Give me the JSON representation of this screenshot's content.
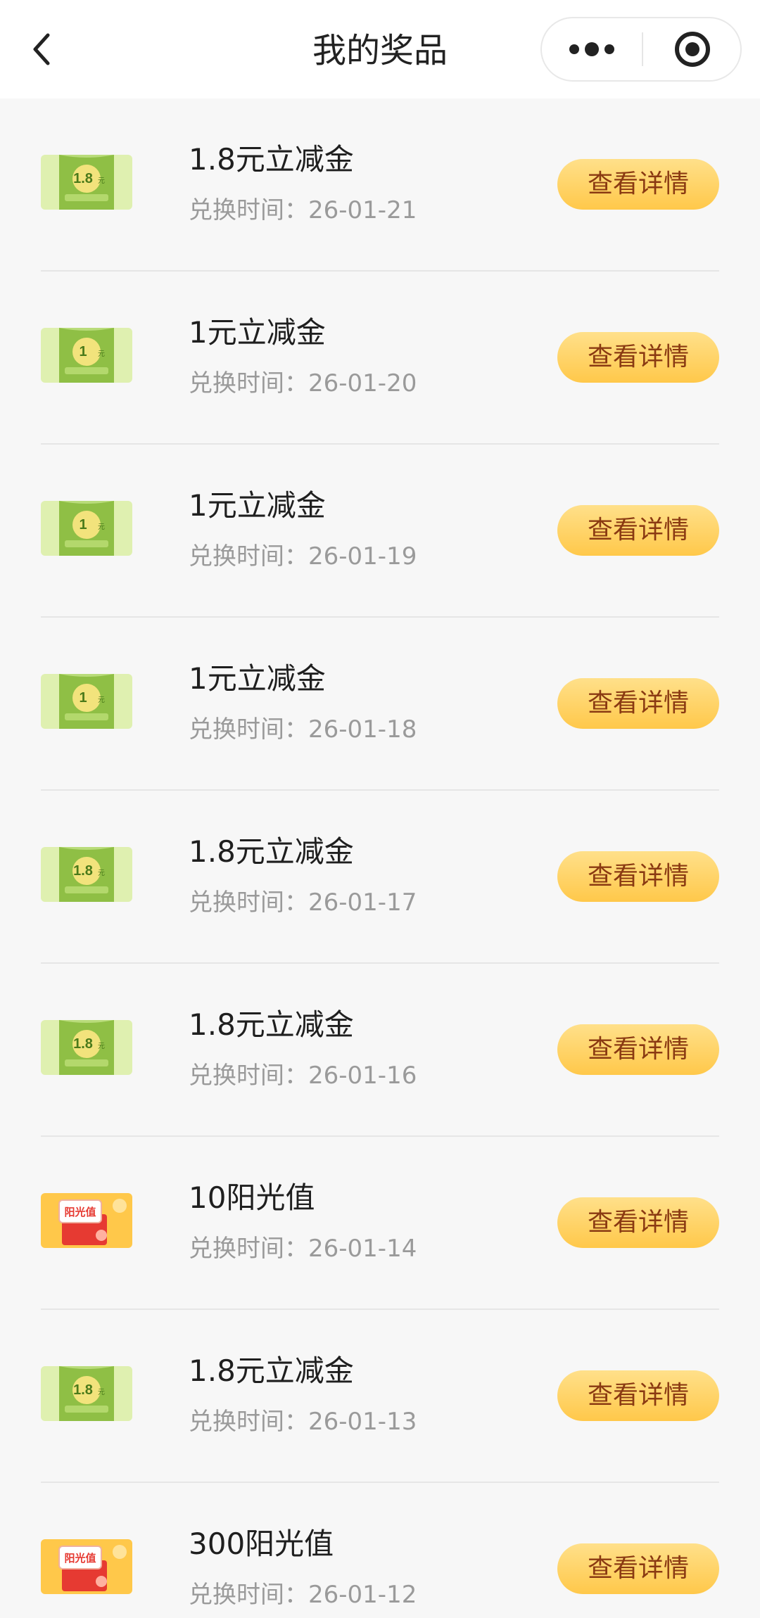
{
  "header": {
    "title": "我的奖品"
  },
  "button_label": "查看详情",
  "time_prefix": "兑换时间：",
  "items": [
    {
      "title": "1.8元立减金",
      "date": "26-01-21",
      "icon": "green-coupon-1.8",
      "badge": "1.8",
      "unit": "元"
    },
    {
      "title": "1元立减金",
      "date": "26-01-20",
      "icon": "green-coupon-1",
      "badge": "1",
      "unit": "元"
    },
    {
      "title": "1元立减金",
      "date": "26-01-19",
      "icon": "green-coupon-1",
      "badge": "1",
      "unit": "元"
    },
    {
      "title": "1元立减金",
      "date": "26-01-18",
      "icon": "green-coupon-1",
      "badge": "1",
      "unit": "元"
    },
    {
      "title": "1.8元立减金",
      "date": "26-01-17",
      "icon": "green-coupon-1.8",
      "badge": "1.8",
      "unit": "元"
    },
    {
      "title": "1.8元立减金",
      "date": "26-01-16",
      "icon": "green-coupon-1.8",
      "badge": "1.8",
      "unit": "元"
    },
    {
      "title": "10阳光值",
      "date": "26-01-14",
      "icon": "sunshine-redpacket",
      "badge": "阳光值",
      "unit": ""
    },
    {
      "title": "1.8元立减金",
      "date": "26-01-13",
      "icon": "green-coupon-1.8",
      "badge": "1.8",
      "unit": "元"
    },
    {
      "title": "300阳光值",
      "date": "26-01-12",
      "icon": "sunshine-redpacket",
      "badge": "阳光值",
      "unit": ""
    }
  ],
  "colors": {
    "background": "#f7f7f7",
    "button_gradient_top": "#ffe08a",
    "button_gradient_bottom": "#ffc84a",
    "button_text": "#8a3a12",
    "coupon_green": "#8fbf45",
    "coupon_bg": "#dff0b0",
    "redpacket_bg": "#ffc84a",
    "redpacket_red": "#e63a32"
  }
}
